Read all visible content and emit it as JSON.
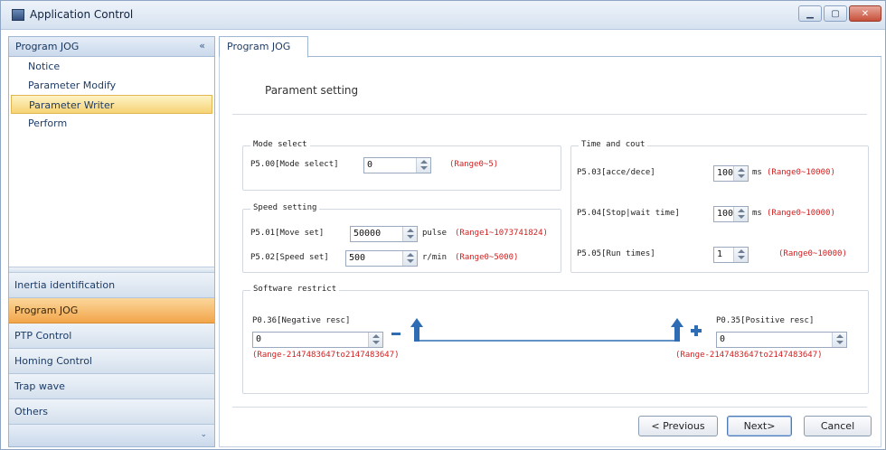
{
  "window": {
    "title": "Application Control"
  },
  "sidebar": {
    "header": "Program JOG",
    "collapse_glyph": "«",
    "items": [
      {
        "label": "Notice"
      },
      {
        "label": "Parameter Modify"
      },
      {
        "label": "Parameter Writer",
        "selected": true
      },
      {
        "label": "Perform"
      }
    ],
    "nav": [
      {
        "label": "Inertia identification"
      },
      {
        "label": "Program JOG",
        "active": true
      },
      {
        "label": "PTP Control"
      },
      {
        "label": "Homing Control"
      },
      {
        "label": "Trap wave"
      },
      {
        "label": "Others"
      }
    ],
    "footer_glyph": "⌄"
  },
  "tab": {
    "label": "Program JOG"
  },
  "page": {
    "heading": "Parament setting"
  },
  "mode_select": {
    "title": "Mode select",
    "p500": {
      "label": "P5.00[Mode select]",
      "value": "0",
      "range": "(Range0~5)"
    }
  },
  "speed_setting": {
    "title": "Speed setting",
    "p501": {
      "label": "P5.01[Move set]",
      "value": "50000",
      "unit": "pulse",
      "range": "(Range1~1073741824)"
    },
    "p502": {
      "label": "P5.02[Speed set]",
      "value": "500",
      "unit": "r/min",
      "range": "(Range0~5000)"
    }
  },
  "time_and_cout": {
    "title": "Time and cout",
    "p503": {
      "label": "P5.03[acce/dece]",
      "value": "100",
      "unit": "ms",
      "range": "(Range0~10000)"
    },
    "p504": {
      "label": "P5.04[Stop|wait time]",
      "value": "100",
      "unit": "ms",
      "range": "(Range0~10000)"
    },
    "p505": {
      "label": "P5.05[Run times]",
      "value": "1",
      "range": "(Range0~10000)"
    }
  },
  "software_restrict": {
    "title": "Software restrict",
    "negative": {
      "label": "P0.36[Negative resc]",
      "value": "0",
      "range": "(Range-2147483647to2147483647)"
    },
    "positive": {
      "label": "P0.35[Positive resc]",
      "value": "0",
      "range": "(Range-2147483647to2147483647)"
    },
    "colors": {
      "line": "#2e6db3",
      "arrow": "#2e6db3"
    }
  },
  "buttons": {
    "previous": "< Previous",
    "next": "Next>",
    "cancel": "Cancel"
  }
}
